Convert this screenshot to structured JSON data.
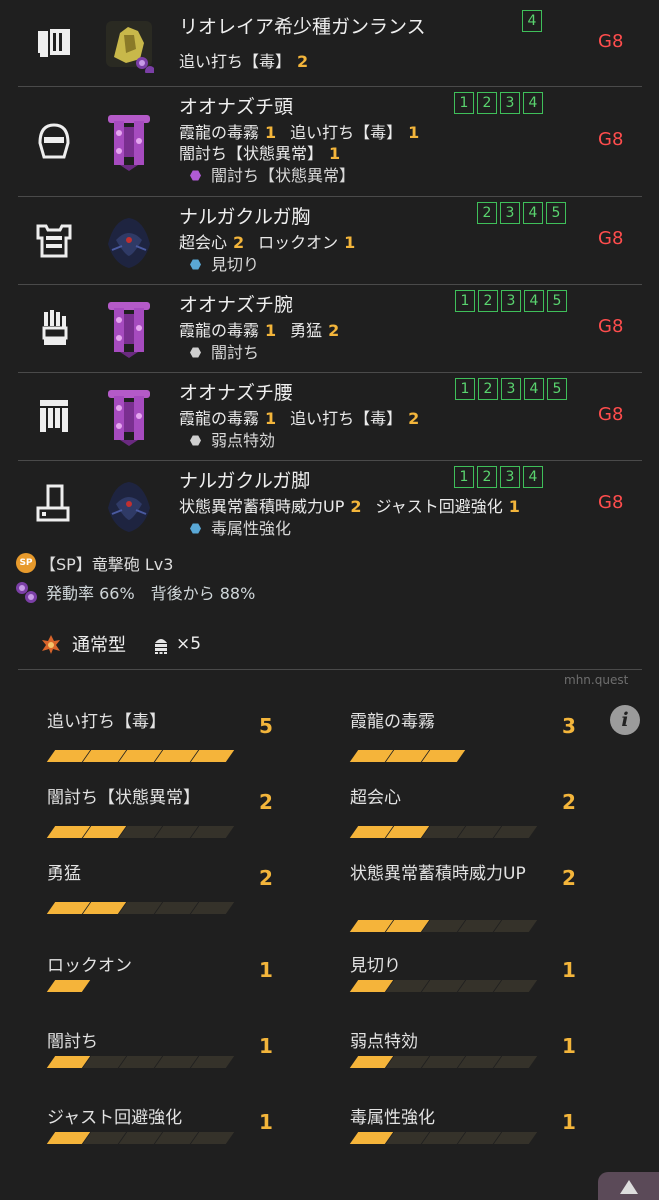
{
  "equipment": [
    {
      "name": "リオレイア希少種ガンランス",
      "skills": [
        {
          "name": "追い打ち【毒】",
          "level": "2"
        }
      ],
      "decoration": "",
      "slots": [
        "4"
      ],
      "grade": "G8",
      "slot_icon": "weapon-icon",
      "monster_icon": "rathalos-icon"
    },
    {
      "name": "オオナズチ頭",
      "skills": [
        {
          "name": "霞龍の毒霧",
          "level": "1"
        },
        {
          "name": "追い打ち【毒】",
          "level": "1"
        }
      ],
      "skills2": [
        {
          "name": "闇討ち【状態異常】",
          "level": "1"
        }
      ],
      "decoration": "闇討ち【状態異常】",
      "deco_color": "#b05bd6",
      "slots": [
        "1",
        "2",
        "3",
        "4"
      ],
      "grade": "G8",
      "slot_icon": "helmet-icon",
      "monster_icon": "chameleos-icon"
    },
    {
      "name": "ナルガクルガ胸",
      "skills": [
        {
          "name": "超会心",
          "level": "2"
        },
        {
          "name": "ロックオン",
          "level": "1"
        }
      ],
      "decoration": "見切り",
      "deco_color": "#5aa8d6",
      "slots": [
        "2",
        "3",
        "4",
        "5"
      ],
      "grade": "G8",
      "slot_icon": "chest-icon",
      "monster_icon": "nargacuga-icon"
    },
    {
      "name": "オオナズチ腕",
      "skills": [
        {
          "name": "霞龍の毒霧",
          "level": "1"
        },
        {
          "name": "勇猛",
          "level": "2"
        }
      ],
      "decoration": "闇討ち",
      "deco_color": "#cfcfcf",
      "slots": [
        "1",
        "2",
        "3",
        "4",
        "5"
      ],
      "grade": "G8",
      "slot_icon": "arm-icon",
      "monster_icon": "chameleos-icon"
    },
    {
      "name": "オオナズチ腰",
      "skills": [
        {
          "name": "霞龍の毒霧",
          "level": "1"
        },
        {
          "name": "追い打ち【毒】",
          "level": "2"
        }
      ],
      "decoration": "弱点特効",
      "deco_color": "#cfcfcf",
      "slots": [
        "1",
        "2",
        "3",
        "4",
        "5"
      ],
      "grade": "G8",
      "slot_icon": "waist-icon",
      "monster_icon": "chameleos-icon"
    },
    {
      "name": "ナルガクルガ脚",
      "skills": [
        {
          "name": "状態異常蓄積時威力UP",
          "level": "2"
        },
        {
          "name": "ジャスト回避強化",
          "level": "1"
        }
      ],
      "decoration": "毒属性強化",
      "deco_color": "#5aa8d6",
      "slots": [
        "1",
        "2",
        "3",
        "4"
      ],
      "grade": "G8",
      "slot_icon": "leg-icon",
      "monster_icon": "nargacuga-icon"
    }
  ],
  "special": {
    "badge": "SP",
    "text": "【SP】竜撃砲 Lv3"
  },
  "rates": "発動率 66%　背後から 88%",
  "ammo": {
    "type": "通常型",
    "count": "×5"
  },
  "watermark": "mhn.quest",
  "info_icon": "i",
  "skill_summary": [
    {
      "name": "追い打ち【毒】",
      "level": "5",
      "max": 5
    },
    {
      "name": "霞龍の毒霧",
      "level": "3",
      "max": 3
    },
    {
      "name": "闇討ち【状態異常】",
      "level": "2",
      "max": 5
    },
    {
      "name": "超会心",
      "level": "2",
      "max": 5
    },
    {
      "name": "勇猛",
      "level": "2",
      "max": 5
    },
    {
      "name": "状態異常蓄積時威力UP",
      "level": "2",
      "max": 5
    },
    {
      "name": "ロックオン",
      "level": "1",
      "max": 1
    },
    {
      "name": "見切り",
      "level": "1",
      "max": 5
    },
    {
      "name": "闇討ち",
      "level": "1",
      "max": 5
    },
    {
      "name": "弱点特効",
      "level": "1",
      "max": 5
    },
    {
      "name": "ジャスト回避強化",
      "level": "1",
      "max": 5
    },
    {
      "name": "毒属性強化",
      "level": "1",
      "max": 5
    }
  ]
}
